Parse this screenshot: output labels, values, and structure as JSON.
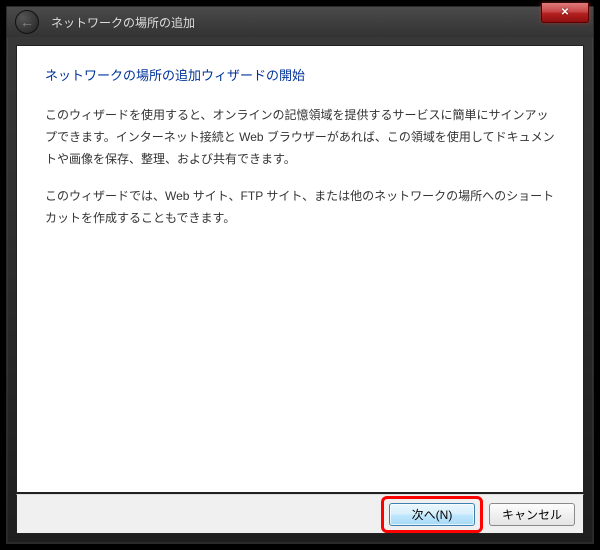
{
  "titlebar": {
    "title": "ネットワークの場所の追加"
  },
  "wizard": {
    "heading": "ネットワークの場所の追加ウィザードの開始",
    "para1": "このウィザードを使用すると、オンラインの記憶領域を提供するサービスに簡単にサインアップできます。インターネット接続と Web ブラウザーがあれば、この領域を使用してドキュメントや画像を保存、整理、および共有できます。",
    "para2": "このウィザードでは、Web サイト、FTP サイト、または他のネットワークの場所へのショートカットを作成することもできます。"
  },
  "footer": {
    "next_label": "次へ(N)",
    "cancel_label": "キャンセル"
  },
  "icons": {
    "back": "←",
    "close": "✕"
  }
}
